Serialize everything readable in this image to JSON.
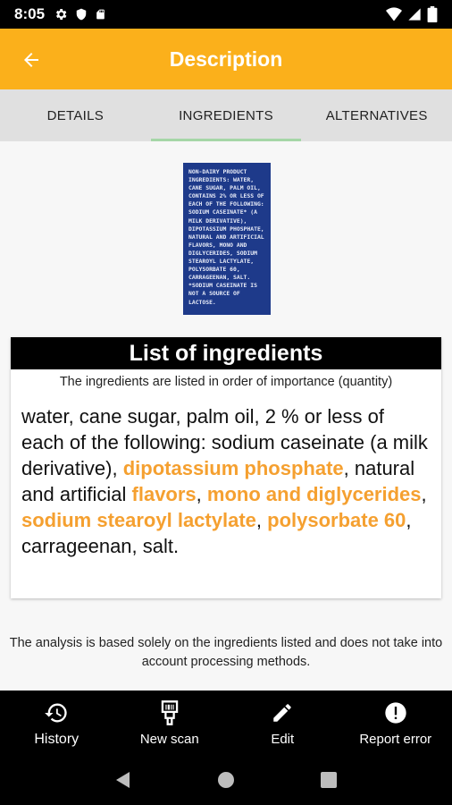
{
  "status_bar": {
    "time": "8:05"
  },
  "app_bar": {
    "title": "Description"
  },
  "tabs": [
    {
      "label": "DETAILS"
    },
    {
      "label": "INGREDIENTS"
    },
    {
      "label": "ALTERNATIVES"
    }
  ],
  "product_label": {
    "text": "NON-DAIRY PRODUCT INGREDIENTS: WATER, CANE SUGAR, PALM OIL, CONTAINS 2% OR LESS OF EACH OF THE FOLLOWING: SODIUM CASEINATE* (A MILK DERIVATIVE), DIPOTASSIUM PHOSPHATE, NATURAL AND ARTIFICIAL FLAVORS, MONO AND DIGLYCERIDES, SODIUM STEAROYL LACTYLATE, POLYSORBATE 60, CARRAGEENAN, SALT. *SODIUM CASEINATE IS NOT A SOURCE OF LACTOSE."
  },
  "ingredients_card": {
    "title": "List of ingredients",
    "subtitle": "The ingredients are listed in order of importance (quantity)",
    "segments": [
      {
        "text": "water, cane sugar, palm oil, 2 % or less of each of the following: sodium caseinate (a milk derivative), ",
        "highlight": false
      },
      {
        "text": "dipotassium phosphate",
        "highlight": true
      },
      {
        "text": ", natural and artificial ",
        "highlight": false
      },
      {
        "text": "flavors",
        "highlight": true
      },
      {
        "text": ", ",
        "highlight": false
      },
      {
        "text": "mono and diglycerides",
        "highlight": true
      },
      {
        "text": ", ",
        "highlight": false
      },
      {
        "text": "sodium stearoyl lactylate",
        "highlight": true
      },
      {
        "text": ", ",
        "highlight": false
      },
      {
        "text": "polysorbate 60",
        "highlight": true
      },
      {
        "text": ", carrageenan, salt.",
        "highlight": false
      }
    ]
  },
  "disclaimer": "The analysis is based solely on the ingredients listed and does not take into account processing methods.",
  "bottom_nav": [
    {
      "label": "History",
      "icon": "history-icon"
    },
    {
      "label": "New scan",
      "icon": "barcode-scanner-icon"
    },
    {
      "label": "Edit",
      "icon": "pencil-icon"
    },
    {
      "label": "Report error",
      "icon": "error-icon"
    }
  ],
  "colors": {
    "accent": "#fbb01b",
    "highlight": "#f5a030",
    "tab_indicator": "#a5d6a7",
    "label_blue": "#1e3a8a"
  }
}
